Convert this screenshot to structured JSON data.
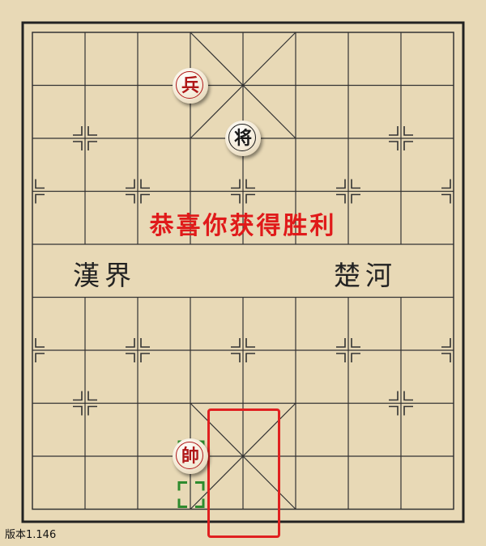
{
  "board": {
    "river_left": "漢界",
    "river_right": "楚河",
    "line_color": "#333333",
    "background": "#e8d9b6"
  },
  "pieces": [
    {
      "id": "red-soldier",
      "label": "兵",
      "side": "red",
      "col": 3,
      "row": 1
    },
    {
      "id": "black-general",
      "label": "将",
      "side": "black",
      "col": 4,
      "row": 2
    },
    {
      "id": "red-marshal",
      "label": "帥",
      "side": "red",
      "col": 3,
      "row": 8
    }
  ],
  "message": "恭喜你获得胜利",
  "message_color": "#e01a1a",
  "highlight_color": "#e02020",
  "hint_color": "#2e8b2e",
  "version_text": "版本1.146"
}
